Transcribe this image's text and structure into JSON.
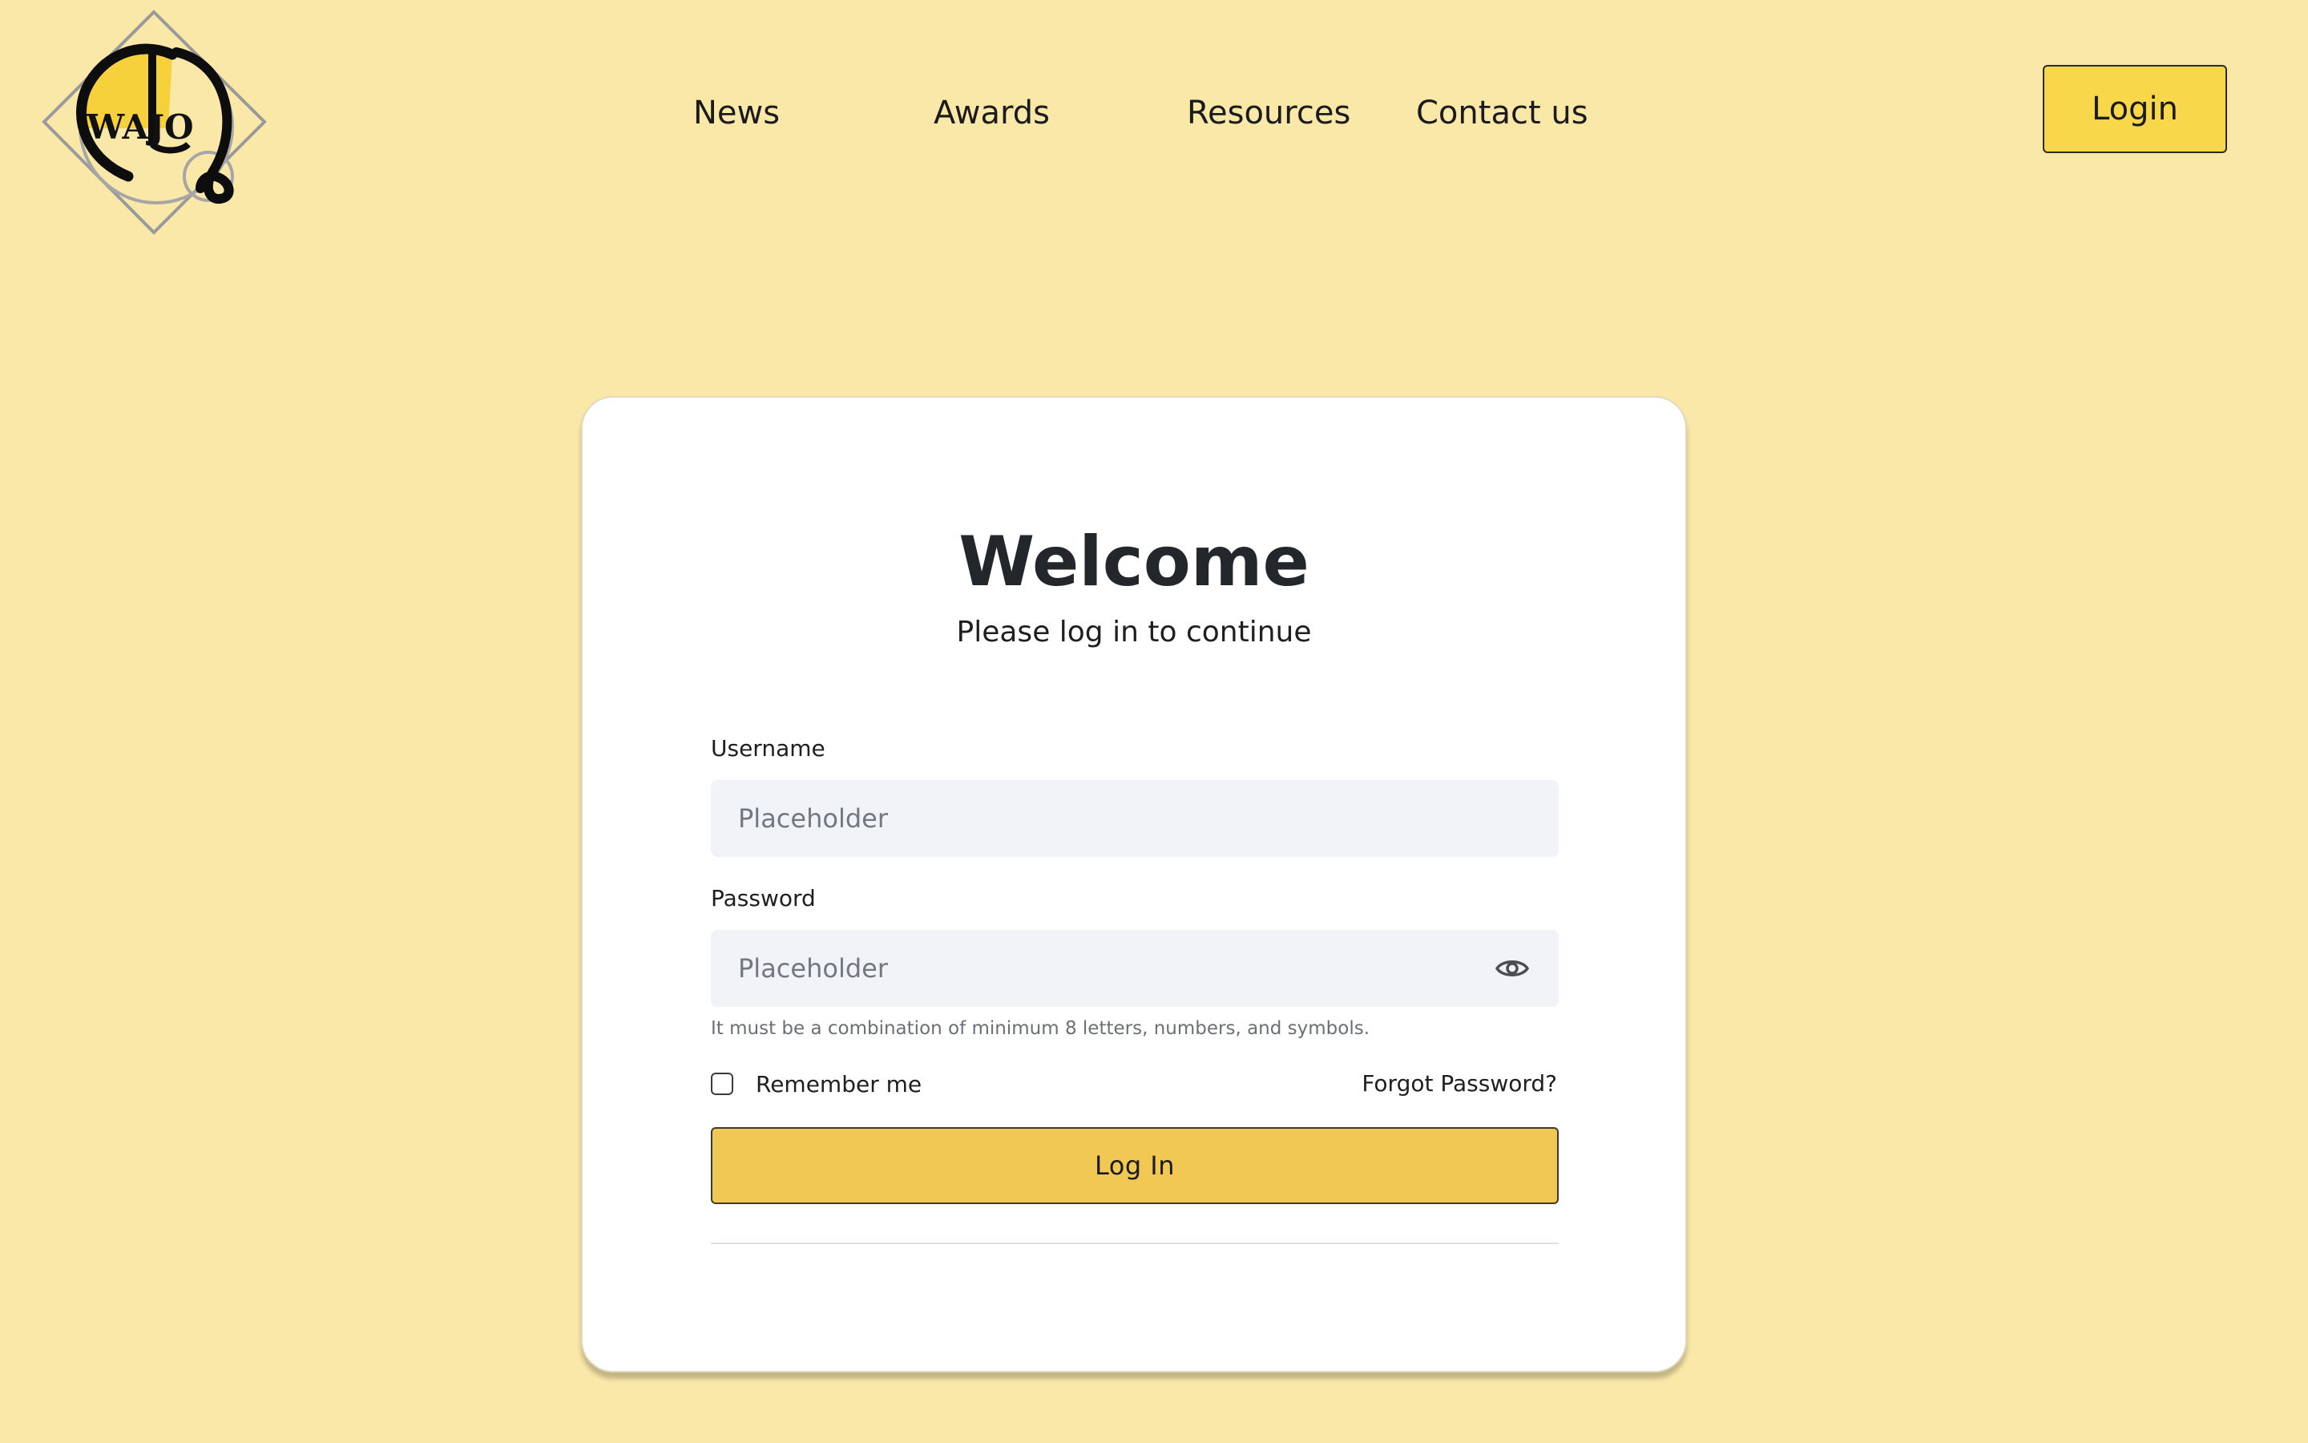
{
  "header": {
    "logo": {
      "text": "WAJO",
      "icon": "wajo-logo"
    },
    "nav": [
      {
        "label": "News"
      },
      {
        "label": "Awards"
      },
      {
        "label": "Resources"
      },
      {
        "label": "Contact us"
      }
    ],
    "login_label": "Login"
  },
  "login": {
    "title": "Welcome",
    "subtitle": "Please log in to continue",
    "username": {
      "label": "Username",
      "value": "",
      "placeholder": "Placeholder"
    },
    "password": {
      "label": "Password",
      "value": "",
      "placeholder": "Placeholder",
      "toggle_icon": "eye-icon",
      "hint": "It must be a combination of minimum 8 letters, numbers, and symbols."
    },
    "remember_label": "Remember me",
    "remember_checked": false,
    "forgot_label": "Forgot Password?",
    "submit_label": "Log In"
  },
  "colors": {
    "page_background": "#fae8a9",
    "card_background": "#ffffff",
    "header_login_button": "#f8d84a",
    "submit_button": "#f1c853",
    "input_background": "#f2f3f6",
    "logo_accent": "#f7d13c"
  }
}
